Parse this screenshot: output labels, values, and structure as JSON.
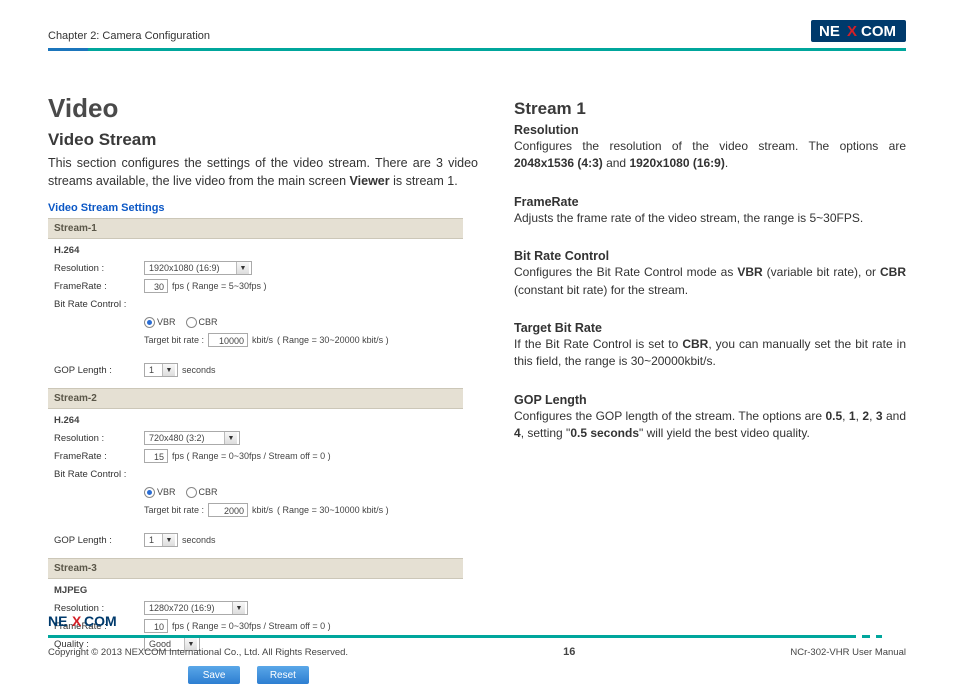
{
  "header": {
    "chapter": "Chapter 2: Camera Configuration"
  },
  "logo": {
    "ne": "NE",
    "x": "X",
    "com": "COM"
  },
  "left": {
    "h1": "Video",
    "h2": "Video Stream",
    "intro_pre": "This section configures the settings of the video stream. There are 3 video streams available, the live video from the main screen ",
    "intro_bold": "Viewer",
    "intro_post": " is stream 1."
  },
  "vss": {
    "title": "Video Stream Settings",
    "labels": {
      "resolution": "Resolution :",
      "framerate": "FrameRate :",
      "bitrate": "Bit Rate Control :",
      "target": "Target bit rate :",
      "gop": "GOP Length :",
      "quality": "Quality :",
      "seconds": "seconds",
      "kbits": "kbit/s"
    },
    "s1": {
      "band": "Stream-1",
      "codec": "H.264",
      "resolution": "1920x1080 (16:9)",
      "fps": "30",
      "fps_note": "fps  ( Range = 5~30fps )",
      "vbr": "VBR",
      "cbr": "CBR",
      "target": "10000",
      "target_note": "( Range = 30~20000 kbit/s )",
      "gop": "1"
    },
    "s2": {
      "band": "Stream-2",
      "codec": "H.264",
      "resolution": "720x480 (3:2)",
      "fps": "15",
      "fps_note": "fps  ( Range = 0~30fps / Stream off = 0 )",
      "vbr": "VBR",
      "cbr": "CBR",
      "target": "2000",
      "target_note": "( Range = 30~10000 kbit/s )",
      "gop": "1"
    },
    "s3": {
      "band": "Stream-3",
      "codec": "MJPEG",
      "resolution": "1280x720 (16:9)",
      "fps": "10",
      "fps_note": "fps  ( Range = 0~30fps / Stream off = 0 )",
      "quality": "Good"
    },
    "buttons": {
      "save": "Save",
      "reset": "Reset"
    }
  },
  "right": {
    "h2": "Stream 1",
    "resolution": {
      "h": "Resolution",
      "pre": "Configures the resolution of the video stream. The options are ",
      "opt1": "2048x1536 (4:3)",
      "mid": " and ",
      "opt2": "1920x1080 (16:9)",
      "post": "."
    },
    "framerate": {
      "h": "FrameRate",
      "p": "Adjusts the frame rate of the video stream, the range is 5~30FPS."
    },
    "brc": {
      "h": "Bit Rate Control",
      "pre": "Configures the Bit Rate Control mode as ",
      "b1": "VBR",
      "mid1": " (variable bit rate), or ",
      "b2": "CBR",
      "post": " (constant bit rate) for the stream."
    },
    "tbr": {
      "h": "Target Bit Rate",
      "pre": "If the Bit Rate Control is set to ",
      "b1": "CBR",
      "post": ", you can manually set the bit rate in this field, the range is 30~20000kbit/s."
    },
    "gop": {
      "h": "GOP Length",
      "pre": "Configures the GOP length of the stream. The options are ",
      "o1": "0.5",
      "c": ", ",
      "o2": "1",
      "o3": "2",
      "o4": "3",
      "and": " and ",
      "o5": "4",
      "mid": ", setting \"",
      "b": "0.5 seconds",
      "post": "\" will yield the best video quality."
    }
  },
  "footer": {
    "copyright": "Copyright © 2013 NEXCOM International Co., Ltd. All Rights Reserved.",
    "page": "16",
    "doc": "NCr-302-VHR User Manual"
  }
}
